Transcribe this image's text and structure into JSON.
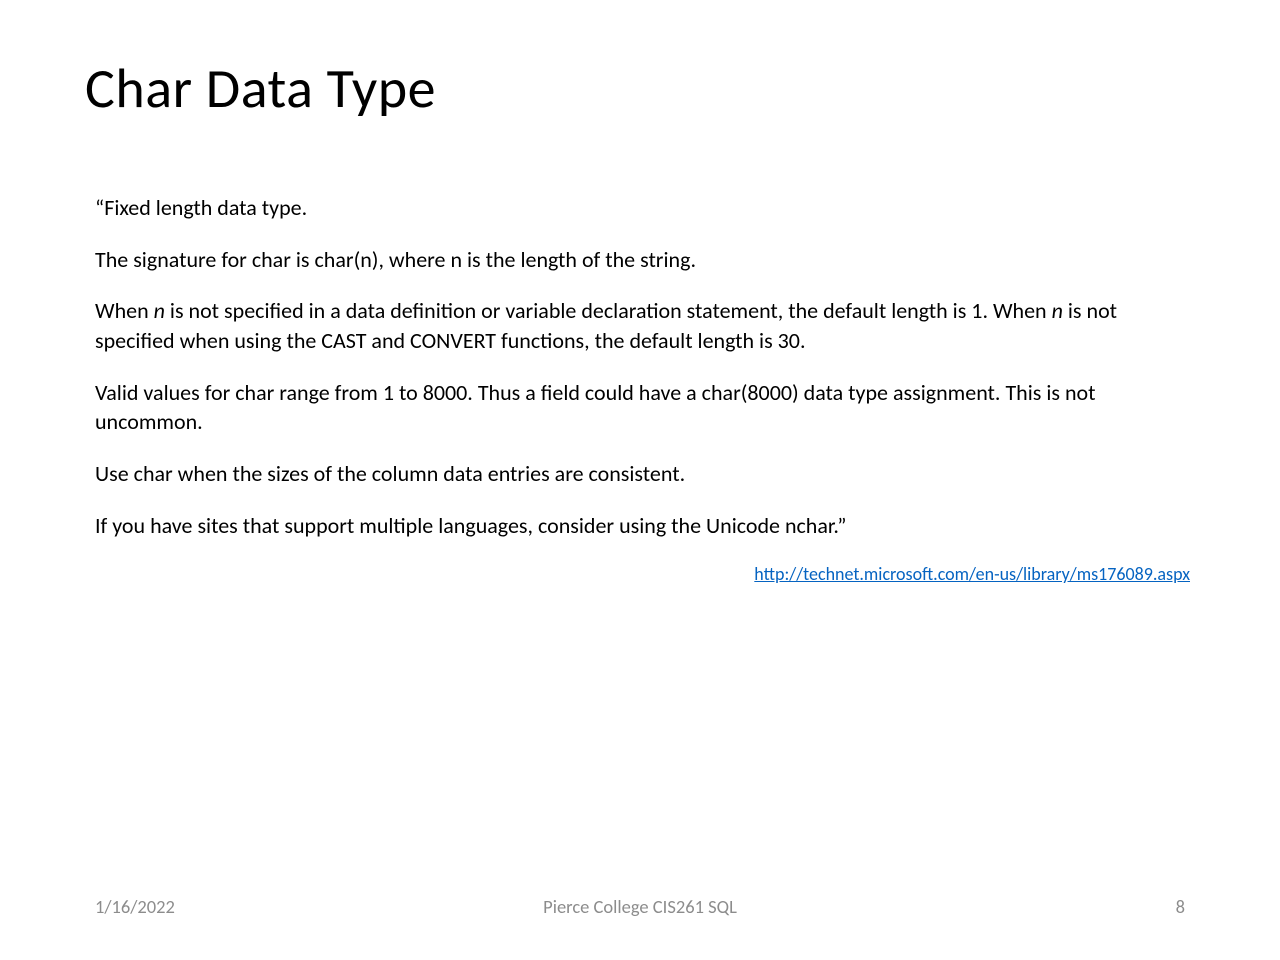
{
  "slide": {
    "title": "Char Data Type",
    "paragraphs": {
      "p1": "“Fixed length data type.",
      "p2": "The signature for char is char(n), where n is the length of the string.",
      "p3a": "When ",
      "p3b": "n",
      "p3c": " is not specified in a data definition or variable declaration statement, the default length is 1. When ",
      "p3d": "n",
      "p3e": " is not specified when using the CAST and CONVERT functions, the default length is 30.",
      "p4": "Valid values for char range from 1 to 8000. Thus a field could have a char(8000) data type assignment. This is not uncommon.",
      "p5": "Use char when the sizes of the column data entries are consistent.",
      "p6": "If you have sites that support multiple languages, consider using the Unicode nchar.”"
    },
    "link": "http://technet.microsoft.com/en-us/library/ms176089.aspx"
  },
  "footer": {
    "date": "1/16/2022",
    "center": "Pierce College CIS261 SQL",
    "page": "8"
  }
}
